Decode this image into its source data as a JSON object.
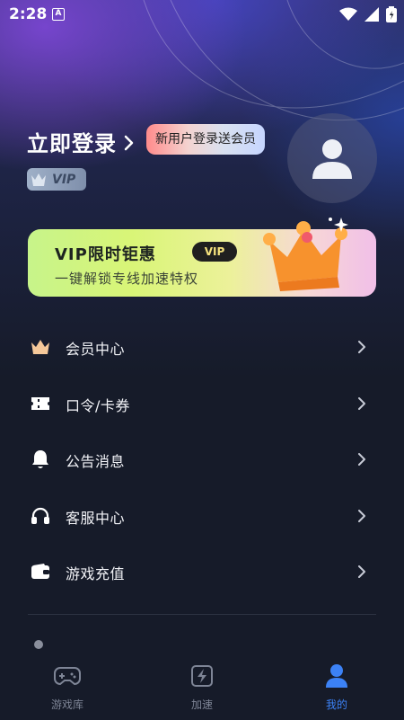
{
  "status_bar": {
    "time": "2:28",
    "notification_letter": "A"
  },
  "profile": {
    "login_label": "立即登录",
    "promo_bubble": "新用户登录送会员",
    "vip_badge": "VIP"
  },
  "vip_banner": {
    "title": "VIP限时钜惠",
    "pill": "VIP",
    "subtitle": "一键解锁专线加速特权"
  },
  "menu": {
    "items": [
      {
        "label": "会员中心",
        "icon": "crown-icon"
      },
      {
        "label": "口令/卡券",
        "icon": "ticket-icon"
      },
      {
        "label": "公告消息",
        "icon": "bell-icon"
      },
      {
        "label": "客服中心",
        "icon": "headphones-icon"
      },
      {
        "label": "游戏充值",
        "icon": "wallet-icon"
      }
    ]
  },
  "bottom_nav": {
    "items": [
      {
        "label": "游戏库",
        "icon": "gamepad-icon",
        "active": false
      },
      {
        "label": "加速",
        "icon": "lightning-icon",
        "active": false
      },
      {
        "label": "我的",
        "icon": "person-icon",
        "active": true
      }
    ]
  },
  "colors": {
    "background": "#161b29",
    "accent": "#3c82f6",
    "vip_gold": "#f5e27d"
  }
}
